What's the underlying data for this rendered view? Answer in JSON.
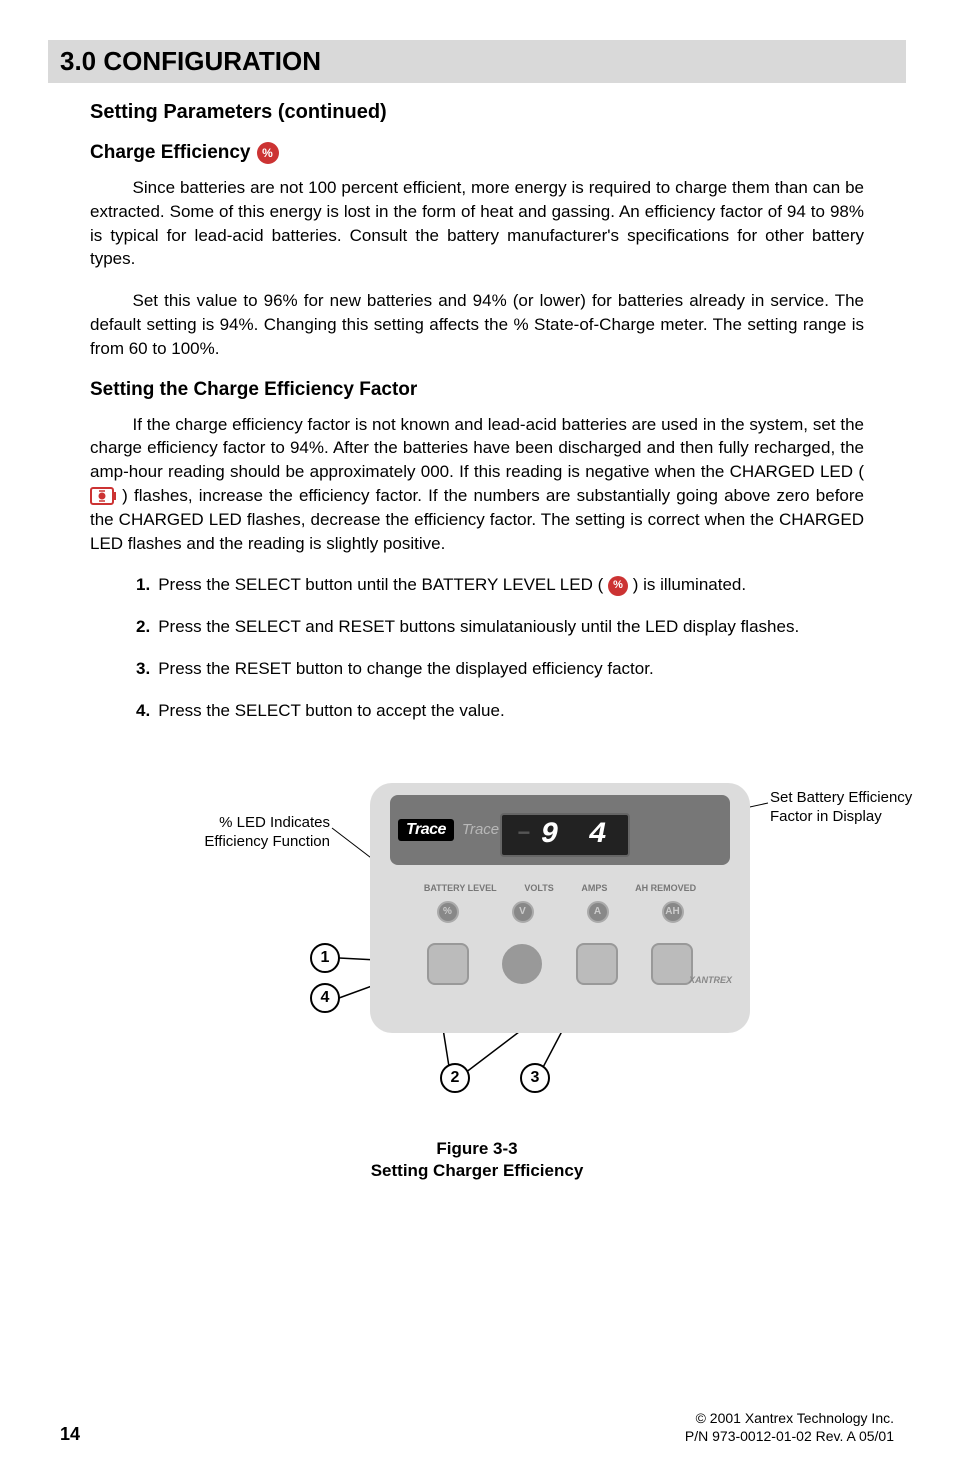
{
  "section_header": "3.0  CONFIGURATION",
  "h2": "Setting Parameters (continued)",
  "h3_charge": "Charge Efficiency",
  "pct_symbol": "%",
  "para1": "Since batteries are not 100 percent efficient, more energy is required to charge them than can be extracted.  Some of this energy is lost in the form of heat and gassing.  An efficiency factor of 94 to 98% is typical for lead-acid batteries.  Consult the battery manufacturer's specifications for other battery types.",
  "para2": "Set this value to 96% for new batteries and 94% (or lower) for batteries already in service.  The default setting is 94%.  Changing this setting affects the % State-of-Charge meter.  The setting range is from 60 to 100%.",
  "h3_setting": "Setting the Charge Efficiency Factor",
  "para3a": "If the charge efficiency factor is not known and lead-acid batteries are used in the system, set the charge efficiency factor to 94%.  After the batteries have been discharged and then fully recharged, the amp-hour reading should be approximately 000. If this reading is negative when the CHARGED LED ( ",
  "para3b": " ) flashes, increase the efficiency factor.  If the numbers are substantially going above zero before the CHARGED LED flashes, decrease the efficiency factor.  The setting is correct when the CHARGED LED flashes and the reading is slightly positive.",
  "steps": [
    {
      "num": "1.",
      "a": "Press the SELECT button until the BATTERY LEVEL LED (",
      "b": ") is illuminated."
    },
    {
      "num": "2.",
      "a": "Press the SELECT and RESET buttons simulataniously until the LED display flashes.",
      "b": ""
    },
    {
      "num": "3.",
      "a": "Press the RESET button to change the displayed efficiency factor.",
      "b": ""
    },
    {
      "num": "4.",
      "a": "Press the SELECT button to accept the value.",
      "b": ""
    }
  ],
  "figure": {
    "brand": "Trace",
    "brand_sub": "Trace Meter",
    "lcd": "9 4",
    "labels": [
      "BATTERY LEVEL",
      "VOLTS",
      "AMPS",
      "AH REMOVED"
    ],
    "xantrex": "XANTREX",
    "callout_left_l1": "% LED Indicates",
    "callout_left_l2": "Efficiency Function",
    "callout_right_l1": "Set Battery Efficiency",
    "callout_right_l2": "Factor in Display",
    "circles": {
      "c1": "1",
      "c2": "2",
      "c3": "3",
      "c4": "4"
    },
    "caption_l1": "Figure 3-3",
    "caption_l2": "Setting Charger Efficiency"
  },
  "footer": {
    "page": "14",
    "copy": "© 2001 Xantrex Technology Inc.",
    "pn": "P/N 973-0012-01-02 Rev. A 05/01"
  }
}
